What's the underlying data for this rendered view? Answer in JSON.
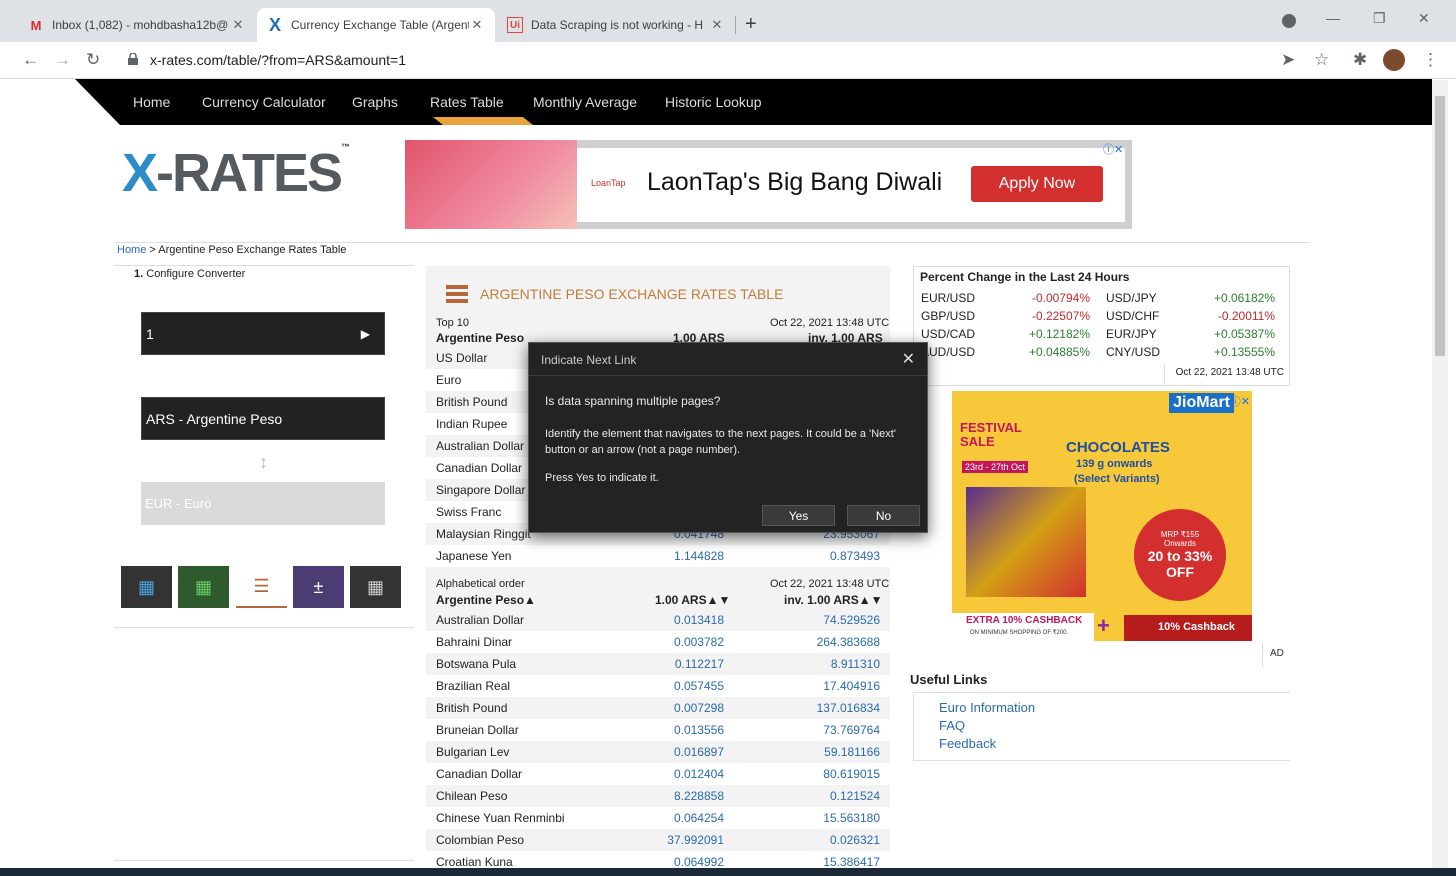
{
  "browser": {
    "tabs": [
      {
        "title": "Inbox (1,082) - mohdbasha12b@",
        "icon": "gmail-icon"
      },
      {
        "title": "Currency Exchange Table (Argent",
        "icon": "xrates-icon"
      },
      {
        "title": "Data Scraping is not working - H",
        "icon": "uipath-icon"
      }
    ],
    "url": "x-rates.com/table/?from=ARS&amount=1"
  },
  "site": {
    "nav": [
      "Home",
      "Currency Calculator",
      "Graphs",
      "Rates Table",
      "Monthly Average",
      "Historic Lookup"
    ],
    "logo_prefix": "X",
    "logo_rest": "-RATES",
    "logo_tm": "™",
    "banner": {
      "brand": "LoanTap",
      "title": "LaonTap's Big Bang Diwali",
      "button": "Apply Now"
    },
    "breadcrumb": {
      "home": "Home",
      "rest": " > Argentine Peso Exchange Rates Table"
    }
  },
  "converter": {
    "step_label": "1.",
    "config_label": "Configure Converter",
    "amount": "1",
    "amount_arrow": "▶",
    "from": "ARS - Argentine Peso",
    "to": "EUR - Euro",
    "swap": "↕"
  },
  "rates": {
    "title": "ARGENTINE PESO EXCHANGE RATES TABLE",
    "top10_label": "Top 10",
    "timestamp": "Oct 22, 2021 13:48 UTC",
    "base_col": "Argentine Peso",
    "col1": "1.00 ARS",
    "col2": "inv. 1.00 ARS",
    "top10": [
      {
        "name": "US Dollar",
        "v1": "",
        "v2": ""
      },
      {
        "name": "Euro",
        "v1": "",
        "v2": ""
      },
      {
        "name": "British Pound",
        "v1": "",
        "v2": ""
      },
      {
        "name": "Indian Rupee",
        "v1": "",
        "v2": ""
      },
      {
        "name": "Australian Dollar",
        "v1": "",
        "v2": ""
      },
      {
        "name": "Canadian Dollar",
        "v1": "",
        "v2": ""
      },
      {
        "name": "Singapore Dollar",
        "v1": "",
        "v2": ""
      },
      {
        "name": "Swiss Franc",
        "v1": "",
        "v2": ""
      },
      {
        "name": "Malaysian Ringgit",
        "v1": "0.041748",
        "v2": "23.953067"
      },
      {
        "name": "Japanese Yen",
        "v1": "1.144828",
        "v2": "0.873493"
      }
    ],
    "alpha_label": "Alphabetical order",
    "alpha_base_col": "Argentine Peso▲",
    "alpha_col1": "1.00 ARS▲▼",
    "alpha_col2": "inv. 1.00 ARS▲▼",
    "alpha": [
      {
        "name": "Australian Dollar",
        "v1": "0.013418",
        "v2": "74.529526"
      },
      {
        "name": "Bahraini Dinar",
        "v1": "0.003782",
        "v2": "264.383688"
      },
      {
        "name": "Botswana Pula",
        "v1": "0.112217",
        "v2": "8.911310"
      },
      {
        "name": "Brazilian Real",
        "v1": "0.057455",
        "v2": "17.404916"
      },
      {
        "name": "British Pound",
        "v1": "0.007298",
        "v2": "137.016834"
      },
      {
        "name": "Bruneian Dollar",
        "v1": "0.013556",
        "v2": "73.769764"
      },
      {
        "name": "Bulgarian Lev",
        "v1": "0.016897",
        "v2": "59.181166"
      },
      {
        "name": "Canadian Dollar",
        "v1": "0.012404",
        "v2": "80.619015"
      },
      {
        "name": "Chilean Peso",
        "v1": "8.228858",
        "v2": "0.121524"
      },
      {
        "name": "Chinese Yuan Renminbi",
        "v1": "0.064254",
        "v2": "15.563180"
      },
      {
        "name": "Colombian Peso",
        "v1": "37.992091",
        "v2": "0.026321"
      },
      {
        "name": "Croatian Kuna",
        "v1": "0.064992",
        "v2": "15.386417"
      }
    ]
  },
  "percent_change": {
    "title": "Percent Change in the Last 24 Hours",
    "rows": [
      [
        {
          "pair": "EUR/USD",
          "value": "-0.00794%"
        },
        {
          "pair": "USD/JPY",
          "value": "+0.06182%"
        }
      ],
      [
        {
          "pair": "GBP/USD",
          "value": "-0.22507%"
        },
        {
          "pair": "USD/CHF",
          "value": "-0.20011%"
        }
      ],
      [
        {
          "pair": "USD/CAD",
          "value": "+0.12182%"
        },
        {
          "pair": "EUR/JPY",
          "value": "+0.05387%"
        }
      ],
      [
        {
          "pair": "AUD/USD",
          "value": "+0.04885%"
        },
        {
          "pair": "CNY/USD",
          "value": "+0.13555%"
        }
      ]
    ],
    "timestamp": "Oct 22, 2021 13:48 UTC"
  },
  "side_ad": {
    "brand": "JioMart",
    "festival": "FESTIVAL SALE",
    "dates": "23rd - 27th Oct",
    "product": "CHOCOLATES",
    "sub1": "139 g onwards",
    "sub2": "(Select Variants)",
    "mrp": "MRP ₹155 Onwards",
    "discount": "20 to 33% OFF",
    "cashback": "EXTRA 10% CASHBACK",
    "cashback_sub": "ON MINIMUM SHOPPING OF ₹200.",
    "bank": "10% Cashback",
    "ad_label": "AD"
  },
  "useful_links": {
    "title": "Useful Links",
    "links": [
      "Euro Information",
      "FAQ",
      "Feedback"
    ]
  },
  "dialog": {
    "title": "Indicate Next Link",
    "question": "Is data spanning multiple pages?",
    "body": "Identify the element that navigates to the next pages. It could be a 'Next' button or an arrow (not a page number).",
    "instruction": "Press Yes to indicate it.",
    "yes": "Yes",
    "no": "No"
  },
  "colors": {
    "accent_orange": "#e8a33d",
    "logo_blue": "#2d8bc9",
    "link_blue": "#2a6ab0",
    "negative": "#c62828",
    "positive": "#2e7d32"
  }
}
